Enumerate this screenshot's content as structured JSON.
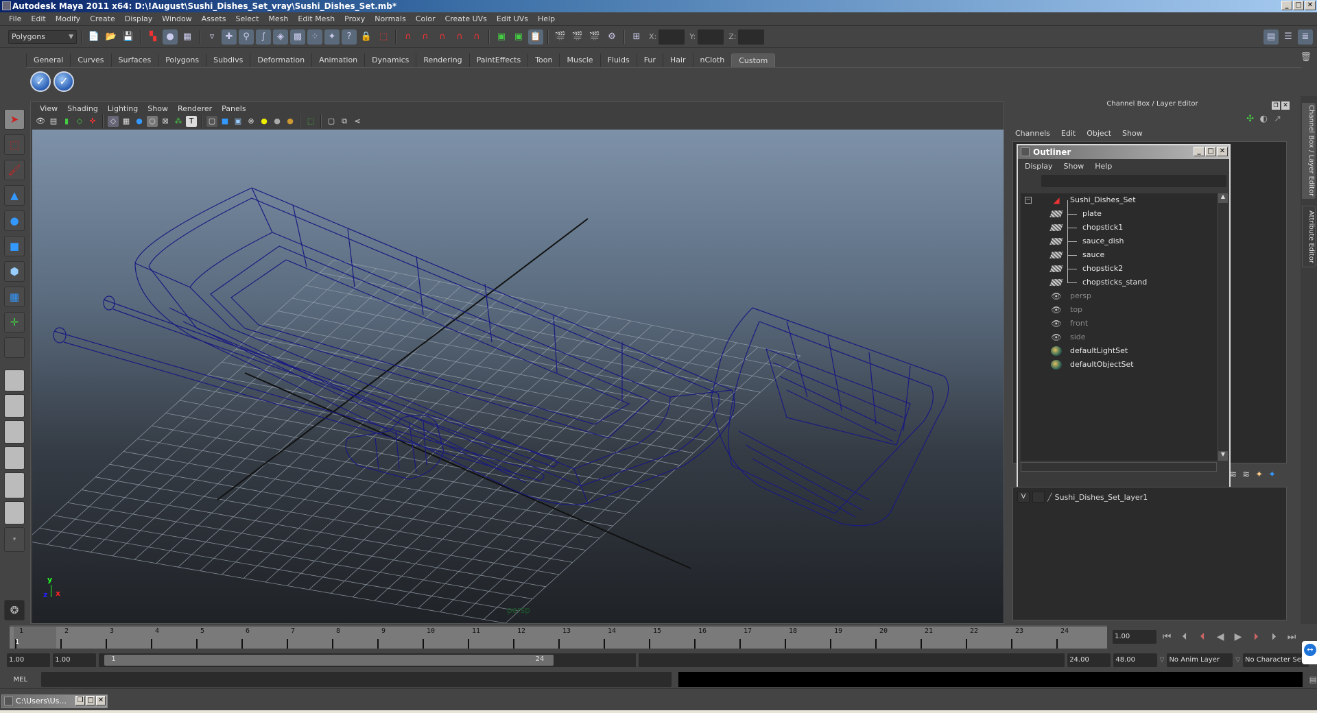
{
  "window": {
    "title": "Autodesk Maya 2011 x64: D:\\!August\\Sushi_Dishes_Set_vray\\Sushi_Dishes_Set.mb*"
  },
  "menubar": [
    "File",
    "Edit",
    "Modify",
    "Create",
    "Display",
    "Window",
    "Assets",
    "Select",
    "Mesh",
    "Edit Mesh",
    "Proxy",
    "Normals",
    "Color",
    "Create UVs",
    "Edit UVs",
    "Help"
  ],
  "statusline": {
    "menu_set": "Polygons",
    "xyz_labels": [
      "X:",
      "Y:",
      "Z:"
    ],
    "xyz_values": [
      "",
      "",
      ""
    ]
  },
  "shelf": {
    "tabs": [
      "General",
      "Curves",
      "Surfaces",
      "Polygons",
      "Subdivs",
      "Deformation",
      "Animation",
      "Dynamics",
      "Rendering",
      "PaintEffects",
      "Toon",
      "Muscle",
      "Fluids",
      "Fur",
      "Hair",
      "nCloth",
      "Custom"
    ],
    "active_tab": "Custom",
    "buttons": [
      "check-icon",
      "check-icon"
    ]
  },
  "viewport": {
    "menu": [
      "View",
      "Shading",
      "Lighting",
      "Show",
      "Renderer",
      "Panels"
    ],
    "camera_label": "persp",
    "axis": {
      "x": "x",
      "y": "y",
      "z": "z"
    },
    "wire_color": "#1a1a80"
  },
  "channel_box": {
    "title": "Channel Box / Layer Editor",
    "menu": [
      "Channels",
      "Edit",
      "Object",
      "Show"
    ]
  },
  "outliner": {
    "title": "Outliner",
    "menu": [
      "Display",
      "Show",
      "Help"
    ],
    "items": [
      {
        "label": "Sushi_Dishes_Set",
        "type": "group",
        "level": 0
      },
      {
        "label": "plate",
        "type": "mesh",
        "level": 1
      },
      {
        "label": "chopstick1",
        "type": "mesh",
        "level": 1
      },
      {
        "label": "sauce_dish",
        "type": "mesh",
        "level": 1
      },
      {
        "label": "sauce",
        "type": "mesh",
        "level": 1
      },
      {
        "label": "chopstick2",
        "type": "mesh",
        "level": 1
      },
      {
        "label": "chopsticks_stand",
        "type": "mesh",
        "level": 1
      },
      {
        "label": "persp",
        "type": "camera",
        "level": 0
      },
      {
        "label": "top",
        "type": "camera",
        "level": 0
      },
      {
        "label": "front",
        "type": "camera",
        "level": 0
      },
      {
        "label": "side",
        "type": "camera",
        "level": 0
      },
      {
        "label": "defaultLightSet",
        "type": "set",
        "level": 0
      },
      {
        "label": "defaultObjectSet",
        "type": "set",
        "level": 0
      }
    ]
  },
  "layer_editor": {
    "layers": [
      {
        "visible": "V",
        "name": "Sushi_Dishes_Set_layer1"
      }
    ]
  },
  "side_tabs": [
    "Channel Box / Layer Editor",
    "Attribute Editor"
  ],
  "timeline": {
    "frames": [
      "1",
      "2",
      "3",
      "4",
      "5",
      "6",
      "7",
      "8",
      "9",
      "10",
      "11",
      "12",
      "13",
      "14",
      "15",
      "16",
      "17",
      "18",
      "19",
      "20",
      "21",
      "22",
      "23",
      "24"
    ],
    "current_frame": "1",
    "current_time": "1.00"
  },
  "range": {
    "start": "1.00",
    "anim_start": "1.00",
    "range_start_label": "1",
    "range_end_label": "24",
    "range_end": "24.00",
    "anim_end": "48.00",
    "anim_layer": "No Anim Layer",
    "character_set": "No Character Set"
  },
  "command_line": {
    "label": "MEL",
    "value": ""
  },
  "taskbar": {
    "item": "C:\\Users\\Us..."
  }
}
